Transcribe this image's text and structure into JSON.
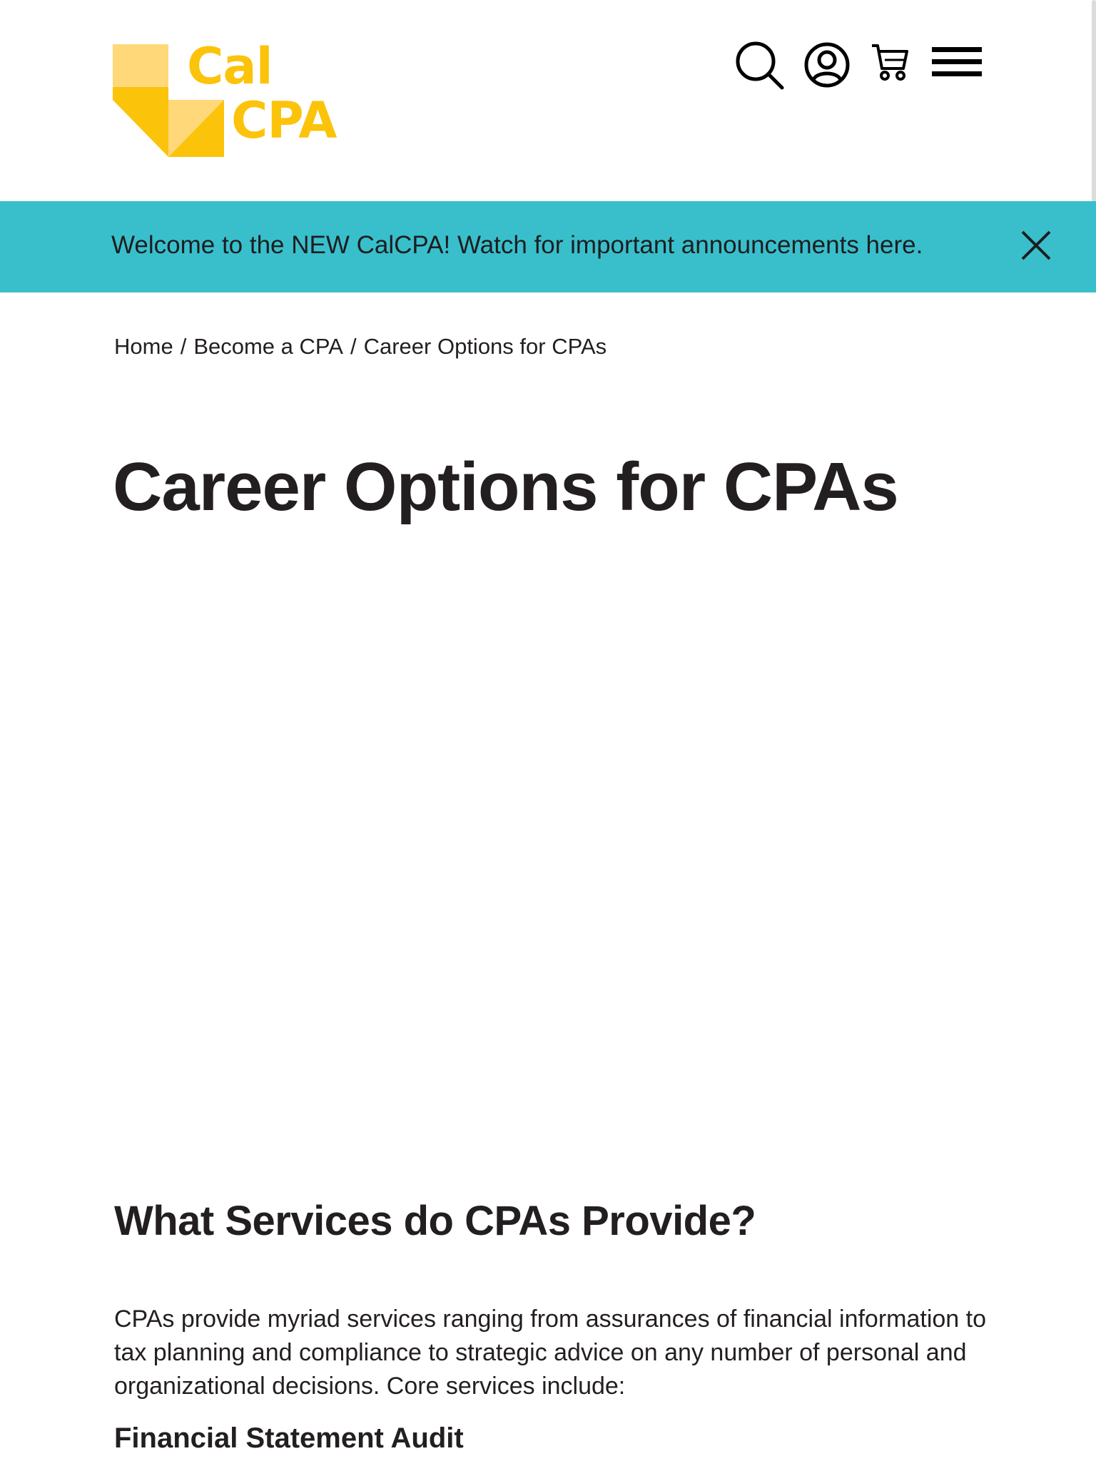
{
  "header": {
    "logo": {
      "line1": "Cal",
      "line2": "CPA",
      "color": "#fcc30b",
      "light_color": "#ffd87a"
    },
    "icons": [
      {
        "name": "search-icon"
      },
      {
        "name": "account-icon"
      },
      {
        "name": "cart-icon"
      },
      {
        "name": "menu-icon"
      }
    ]
  },
  "announcement": {
    "text": "Welcome to the NEW CalCPA! Watch for important announcements here.",
    "background": "#39bfcc",
    "close_icon": "close-icon"
  },
  "breadcrumb": {
    "items": [
      "Home",
      "Become a CPA",
      "Career Options for CPAs"
    ],
    "separator": "/"
  },
  "page": {
    "title": "Career Options for CPAs"
  },
  "section": {
    "heading": "What Services do CPAs Provide?",
    "intro": "CPAs provide myriad services ranging from assurances of financial information to tax planning and compliance to strategic advice on any number of personal and organizational decisions. Core services include:",
    "subheading": "Financial Statement Audit"
  }
}
